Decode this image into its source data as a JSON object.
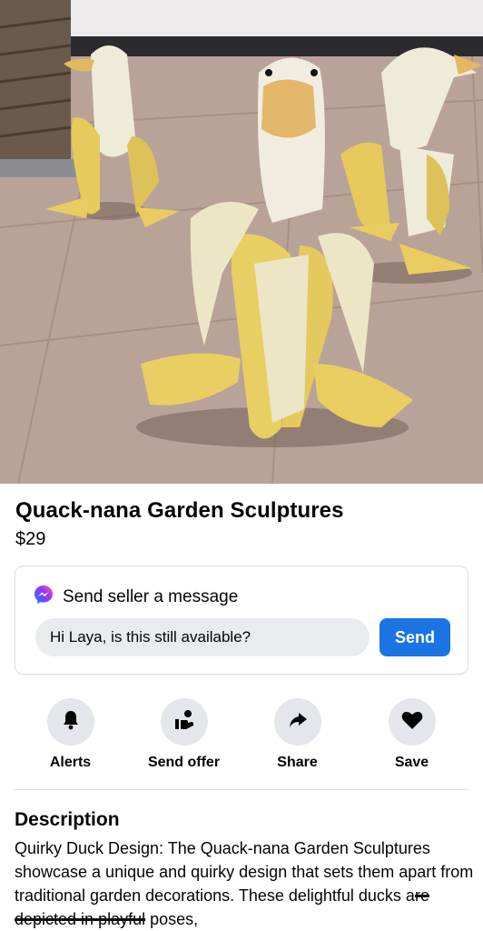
{
  "listing": {
    "title": "Quack-nana Garden Sculptures",
    "price": "$29"
  },
  "message_card": {
    "heading": "Send seller a message",
    "input_value": "Hi Laya, is this still available?",
    "send_label": "Send",
    "icon": "messenger-icon"
  },
  "actions": [
    {
      "label": "Alerts",
      "icon": "bell-icon"
    },
    {
      "label": "Send offer",
      "icon": "offer-hand-icon"
    },
    {
      "label": "Share",
      "icon": "share-arrow-icon"
    },
    {
      "label": "Save",
      "icon": "heart-icon"
    }
  ],
  "description": {
    "heading": "Description",
    "text_before": "Quirky Duck Design: The Quack-nana Garden Sculptures showcase a unique and quirky design that sets them apart from traditional garden decorations. These delightful ducks a",
    "text_struck": "re depicted in playful",
    "text_after": " poses,"
  },
  "colors": {
    "accent": "#1b74e4",
    "icon_bg": "#e4e6eb",
    "input_bg": "#e9ebee"
  }
}
